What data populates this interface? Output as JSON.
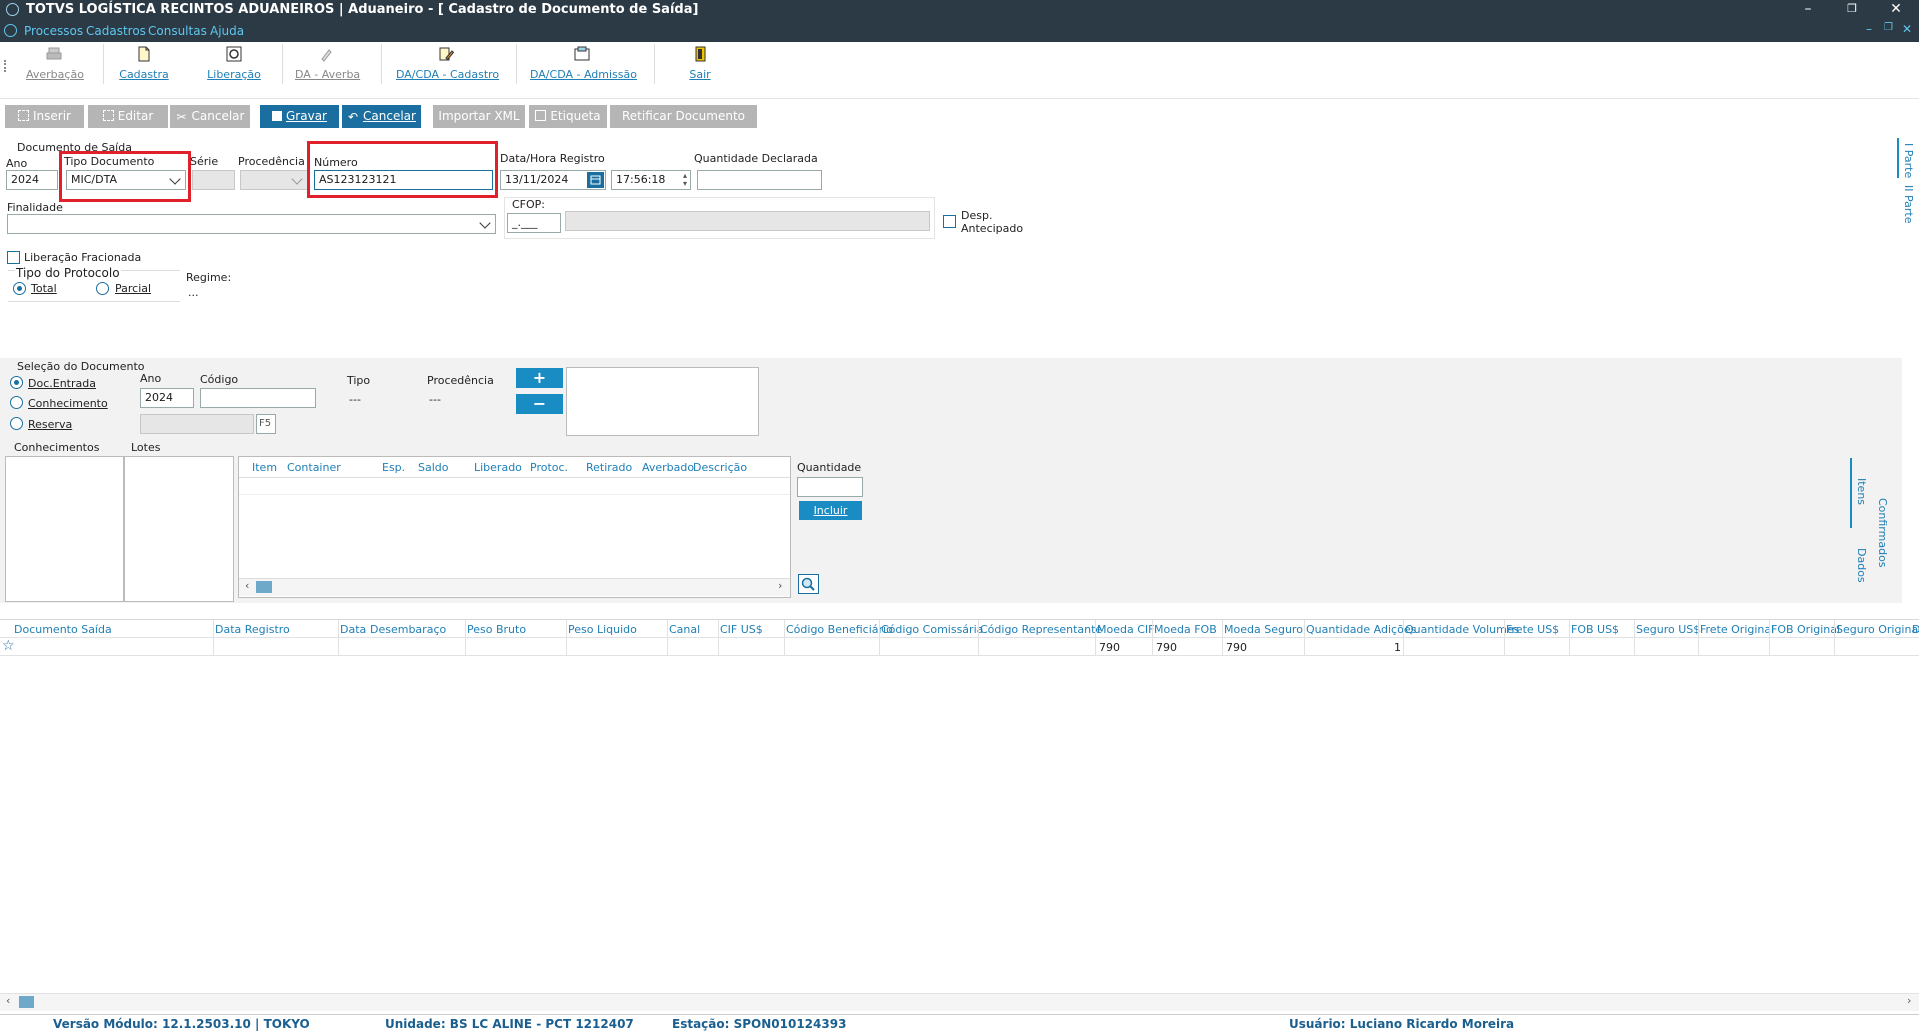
{
  "window": {
    "title": "TOTVS LOGÍSTICA RECINTOS ADUANEIROS | Aduaneiro - [ Cadastro de Documento de Saída]"
  },
  "menu": [
    "Processos",
    "Cadastros",
    "Consultas",
    "Ajuda"
  ],
  "toolbar": [
    "Averbação",
    "Cadastra",
    "Liberação",
    "DA - Averba",
    "DA/CDA - Cadastro",
    "DA/CDA - Admissão",
    "Sair"
  ],
  "actions": [
    "Inserir",
    "Editar",
    "Cancelar",
    "Gravar",
    "Cancelar",
    "Importar XML",
    "Etiqueta",
    "Retificar Documento"
  ],
  "form": {
    "group_title": "Documento de Saída",
    "ano_label": "Ano",
    "ano_value": "2024",
    "tipo_label": "Tipo Documento",
    "tipo_value": "MIC/DTA",
    "serie_label": "Série",
    "procedencia_label": "Procedência",
    "numero_label": "Número",
    "numero_value": "AS123123121",
    "datahora_label": "Data/Hora Registro",
    "data_value": "13/11/2024",
    "hora_value": "17:56:18",
    "qtd_label": "Quantidade Declarada",
    "finalidade_label": "Finalidade",
    "cfop_label": "CFOP:",
    "cfop_value": "_.___",
    "desp_label_1": "Desp.",
    "desp_label_2": "Antecipado",
    "liberacao_label": "Liberação Fracionada",
    "protocolo_title": "Tipo do Protocolo",
    "total_label": "Total",
    "parcial_label": "Parcial",
    "regime_label": "Regime:",
    "regime_value": "..."
  },
  "side_tabs": [
    "I Parte",
    "II Parte"
  ],
  "selecao": {
    "title": "Seleção do Documento",
    "options": [
      "Doc.Entrada",
      "Conhecimento",
      "Reserva"
    ],
    "ano_label": "Ano",
    "ano_value": "2024",
    "codigo_label": "Código",
    "tipo_label": "Tipo",
    "tipo_value": "---",
    "procedencia_label": "Procedência",
    "procedencia_value": "---",
    "f5_label": "F5",
    "plus": "+",
    "minus": "−"
  },
  "lists": {
    "conhecimentos": "Conhecimentos",
    "lotes": "Lotes"
  },
  "items_table": {
    "headers": [
      "Item",
      "Container",
      "Esp.",
      "Saldo",
      "Liberado",
      "Protoc.",
      "Retirado",
      "Averbado",
      "Descrição"
    ]
  },
  "quantidade": {
    "label": "Quantidade",
    "button": "Incluir"
  },
  "items_tabs": [
    "Itens",
    "Dados",
    "Confirmados"
  ],
  "grid": {
    "headers": [
      "Documento Saída",
      "Data Registro",
      "Data",
      "Desembaraço",
      "Peso Bruto",
      "Peso Liquido",
      "Canal",
      "CIF US$",
      "Código Beneficiário",
      "Código Comissária",
      "Código Representante",
      "Moeda CIF",
      "Moeda FOB",
      "Moeda Seguro",
      "Quantidade Adições",
      "Quantidade Volumes",
      "Frete US$",
      "FOB US$",
      "Seguro US$",
      "Frete Original",
      "FOB Original",
      "Seguro Original",
      "D"
    ],
    "row": {
      "moeda_cif": "790",
      "moeda_fob": "790",
      "moeda_seguro": "790",
      "qtd_adicoes": "1"
    }
  },
  "status": {
    "versao": "Versão Módulo:  12.1.2503.10  |  TOKYO",
    "unidade": "Unidade: BS LC ALINE - PCT 1212407",
    "estacao": "Estação: SPON010124393",
    "usuario": "Usuário: Luciano Ricardo Moreira"
  },
  "colors": {
    "titlebar": "#2b3a45",
    "accent": "#1a6fa0",
    "link": "#1f7fb6",
    "highlight": "#e0202b"
  }
}
